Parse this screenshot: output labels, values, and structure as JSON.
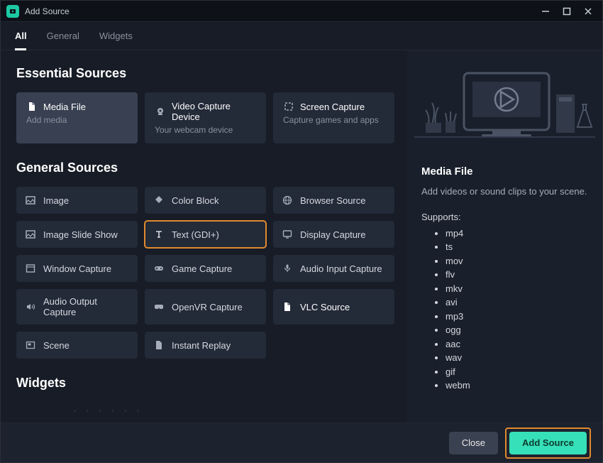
{
  "window": {
    "title": "Add Source"
  },
  "tabs": [
    {
      "label": "All",
      "active": true
    },
    {
      "label": "General",
      "active": false
    },
    {
      "label": "Widgets",
      "active": false
    }
  ],
  "sections": {
    "essential": {
      "title": "Essential Sources",
      "cards": [
        {
          "icon": "file-icon",
          "title": "Media File",
          "subtitle": "Add media",
          "selected": true
        },
        {
          "icon": "webcam-icon",
          "title": "Video Capture Device",
          "subtitle": "Your webcam device",
          "selected": false
        },
        {
          "icon": "crop-icon",
          "title": "Screen Capture",
          "subtitle": "Capture games and apps",
          "selected": false
        }
      ]
    },
    "general": {
      "title": "General Sources",
      "cards": [
        {
          "icon": "image-icon",
          "label": "Image"
        },
        {
          "icon": "palette-icon",
          "label": "Color Block"
        },
        {
          "icon": "globe-icon",
          "label": "Browser Source"
        },
        {
          "icon": "image-icon",
          "label": "Image Slide Show"
        },
        {
          "icon": "text-icon",
          "label": "Text (GDI+)",
          "outlined": true
        },
        {
          "icon": "monitor-icon",
          "label": "Display Capture"
        },
        {
          "icon": "window-icon",
          "label": "Window Capture"
        },
        {
          "icon": "gamepad-icon",
          "label": "Game Capture"
        },
        {
          "icon": "mic-icon",
          "label": "Audio Input Capture"
        },
        {
          "icon": "speaker-icon",
          "label": "Audio Output Capture"
        },
        {
          "icon": "vr-icon",
          "label": "OpenVR Capture"
        },
        {
          "icon": "file-icon",
          "label": "VLC Source",
          "highlight": true
        },
        {
          "icon": "scene-icon",
          "label": "Scene"
        },
        {
          "icon": "replay-icon",
          "label": "Instant Replay"
        }
      ]
    },
    "widgets": {
      "title": "Widgets"
    }
  },
  "detail": {
    "title": "Media File",
    "description": "Add videos or sound clips to your scene.",
    "supports_label": "Supports:",
    "formats": [
      "mp4",
      "ts",
      "mov",
      "flv",
      "mkv",
      "avi",
      "mp3",
      "ogg",
      "aac",
      "wav",
      "gif",
      "webm"
    ]
  },
  "footer": {
    "close": "Close",
    "add": "Add Source"
  }
}
